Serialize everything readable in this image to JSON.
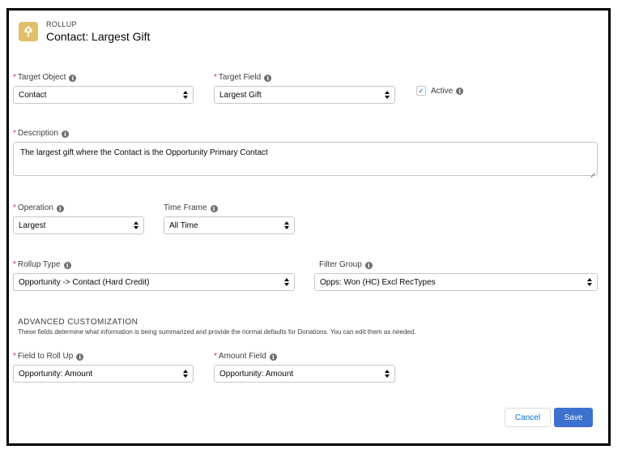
{
  "header": {
    "eyebrow": "ROLLUP",
    "title": "Contact: Largest Gift",
    "icon": "rollup-icon",
    "icon_color": "#dfc069"
  },
  "fields": {
    "target_object": {
      "label": "Target Object",
      "value": "Contact",
      "required": true
    },
    "target_field": {
      "label": "Target Field",
      "value": "Largest Gift",
      "required": true
    },
    "active": {
      "label": "Active",
      "checked": true
    },
    "description": {
      "label": "Description",
      "value": "The largest gift where the Contact is the Opportunity Primary Contact",
      "required": true
    },
    "operation": {
      "label": "Operation",
      "value": "Largest",
      "required": true
    },
    "time_frame": {
      "label": "Time Frame",
      "value": "All Time",
      "required": false
    },
    "rollup_type": {
      "label": "Rollup Type",
      "value": "Opportunity -> Contact (Hard Credit)",
      "required": true
    },
    "filter_group": {
      "label": "Filter Group",
      "value": "Opps: Won (HC) Excl RecTypes",
      "required": false
    },
    "field_to_roll_up": {
      "label": "Field to Roll Up",
      "value": "Opportunity: Amount",
      "required": true
    },
    "amount_field": {
      "label": "Amount Field",
      "value": "Opportunity: Amount",
      "required": true
    }
  },
  "advanced": {
    "title": "ADVANCED CUSTOMIZATION",
    "description": "These fields determine what information is being summarized and provide the normal defaults for Donations. You can edit them as needed."
  },
  "buttons": {
    "cancel": "Cancel",
    "save": "Save"
  },
  "colors": {
    "primary": "#3c71cf",
    "required": "#c23934",
    "link": "#0070d2"
  },
  "symbols": {
    "required": "*",
    "info": "i",
    "check": "✓"
  }
}
